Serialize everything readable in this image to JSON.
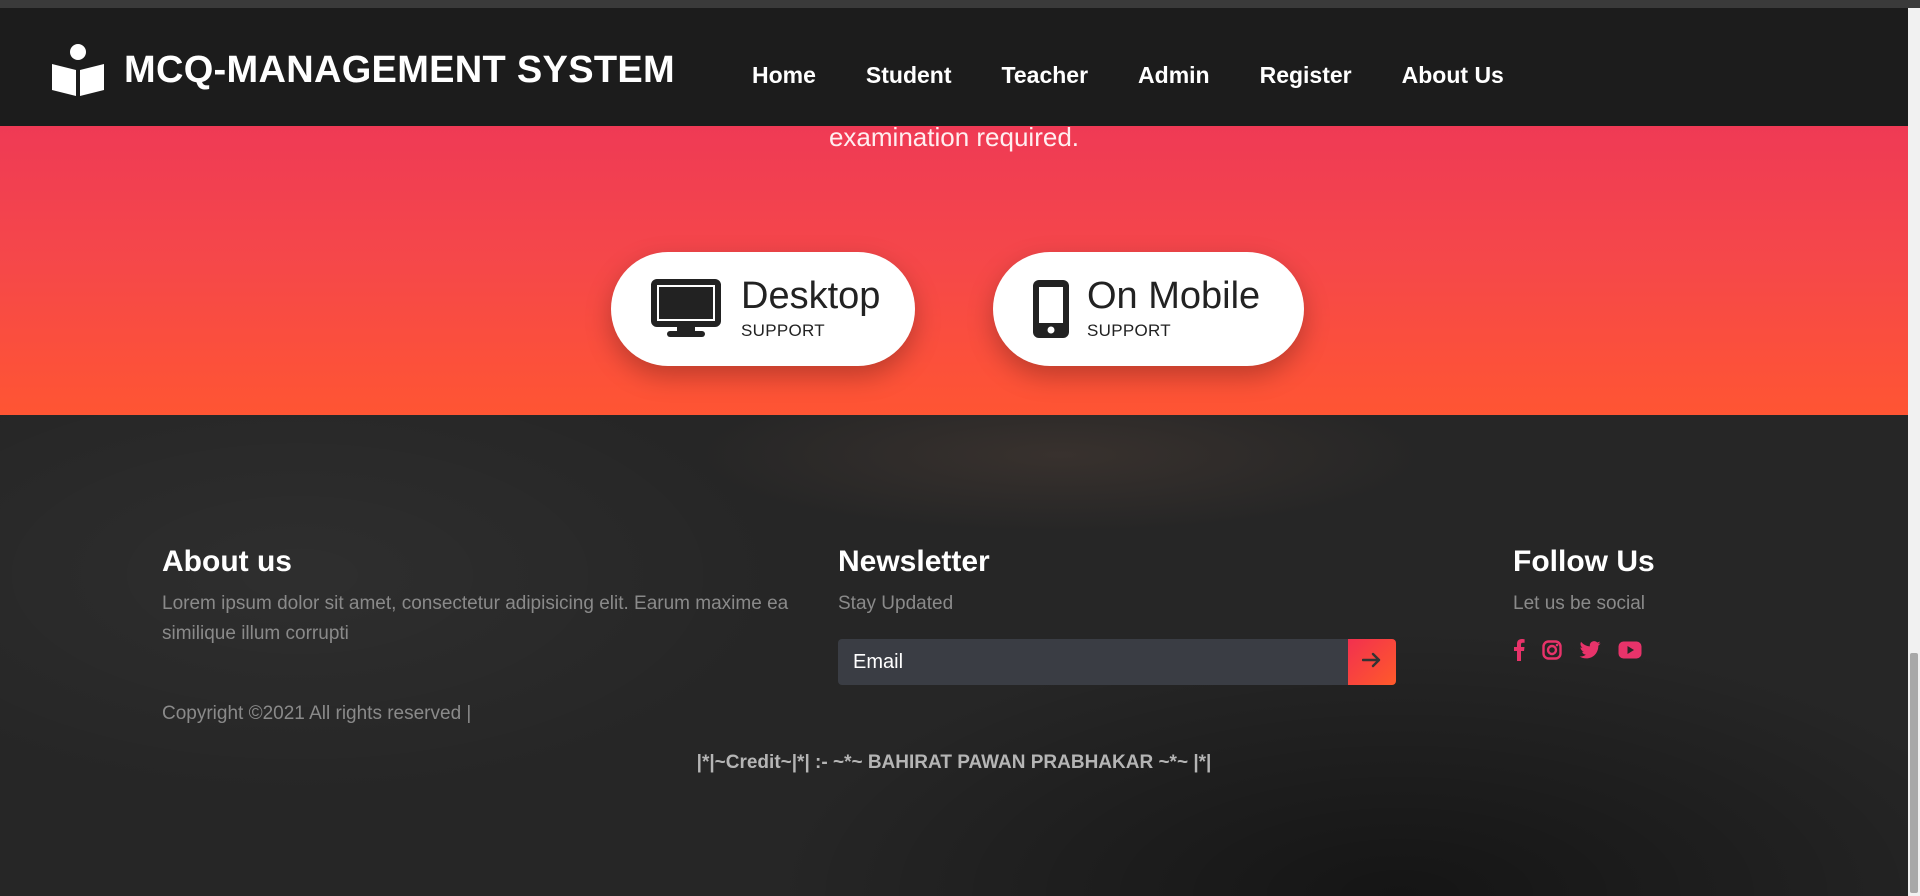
{
  "brand": {
    "title": "MCQ-MANAGEMENT SYSTEM",
    "icon": "book-reader-icon"
  },
  "nav": {
    "items": [
      {
        "label": "Home"
      },
      {
        "label": "Student"
      },
      {
        "label": "Teacher"
      },
      {
        "label": "Admin"
      },
      {
        "label": "Register"
      },
      {
        "label": "About Us"
      }
    ]
  },
  "hero": {
    "text": "examination required.",
    "cards": [
      {
        "title": "Desktop",
        "subtitle": "SUPPORT",
        "icon": "desktop-icon"
      },
      {
        "title": "On Mobile",
        "subtitle": "SUPPORT",
        "icon": "mobile-icon"
      }
    ]
  },
  "footer": {
    "about": {
      "heading": "About us",
      "text": "Lorem ipsum dolor sit amet, consectetur adipisicing elit. Earum maxime ea similique illum corrupti"
    },
    "newsletter": {
      "heading": "Newsletter",
      "subtext": "Stay Updated",
      "email_placeholder": "Email"
    },
    "follow": {
      "heading": "Follow Us",
      "subtext": "Let us be social",
      "icons": [
        "facebook-icon",
        "instagram-icon",
        "twitter-icon",
        "youtube-icon"
      ]
    },
    "copyright": "Copyright ©2021 All rights reserved |",
    "credit": "|*|~Credit~|*| :- ~*~ BAHIRAT PAWAN PRABHAKAR ~*~ |*|"
  },
  "colors": {
    "accent_gradient_start": "#ef3a55",
    "accent_gradient_end": "#ff5533",
    "social_icon": "#e8336a",
    "navbar_bg": "#1c1c1c",
    "footer_bg": "#262626"
  }
}
